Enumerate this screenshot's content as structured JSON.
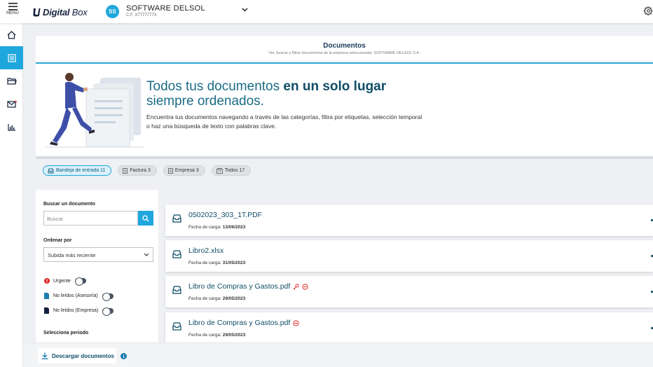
{
  "topbar": {
    "menu_label": "MENÚ",
    "logo_text_bold": "Digital",
    "logo_text_light": "Box",
    "avatar_initials": "SS",
    "company_name": "SOFTWARE DELSOL",
    "company_cif": "C.F. X7777777X"
  },
  "sidebar": {
    "items": [
      {
        "name": "home",
        "icon": "home-icon",
        "active": false
      },
      {
        "name": "documents",
        "icon": "documents-icon",
        "active": true
      },
      {
        "name": "folders",
        "icon": "folder-icon",
        "active": false
      },
      {
        "name": "messages",
        "icon": "mail-icon",
        "active": false
      },
      {
        "name": "reports",
        "icon": "chart-icon",
        "active": false
      }
    ]
  },
  "panel": {
    "title": "Documentos",
    "subtitle": "Ver, buscar y filtrar documentos de la empresa seleccionada: SOFTWARE DELSOL S.A.",
    "hero_title_regular": "Todos tus documentos",
    "hero_title_bold": "en un solo lugar",
    "hero_title_line2": "siempre ordenados.",
    "hero_text": "Encuentra tus documentos navegando a través de las categorías, filtra por etiquetas, selección temporal o haz una búsqueda de texto con palabras clave."
  },
  "tags": [
    {
      "label": "Bandeja de entrada 11",
      "active": true
    },
    {
      "label": "Factura 3",
      "active": false
    },
    {
      "label": "Empresa 3",
      "active": false
    },
    {
      "label": "Todos 17",
      "active": false
    }
  ],
  "filters": {
    "search_label": "Buscar un documento",
    "search_placeholder": "Buscar",
    "order_label": "Ordenar por",
    "order_value": "Subida más reciente",
    "toggle_urgent": "Urgente",
    "toggle_unread_advisory": "No leídos (Asesoría)",
    "toggle_unread_company": "No leídos (Empresa)",
    "period_label": "Selecciona periodo"
  },
  "documents": [
    {
      "name": "0502023_303_1T.PDF",
      "date_label": "Fecha de carga:",
      "date": "13/06/2023",
      "badges": []
    },
    {
      "name": "Libro2.xlsx",
      "date_label": "Fecha de carga:",
      "date": "31/05/2023",
      "badges": []
    },
    {
      "name": "Libro de Compras y Gastos.pdf",
      "date_label": "Fecha de carga:",
      "date": "29/05/2023",
      "badges": [
        "key-icon",
        "blocked-icon"
      ]
    },
    {
      "name": "Libro de Compras y Gastos.pdf",
      "date_label": "Fecha de carga:",
      "date": "29/05/2023",
      "badges": [
        "blocked-icon"
      ]
    }
  ],
  "bottombar": {
    "download_label": "Descargar documentos"
  },
  "colors": {
    "accent": "#1ea7dd",
    "dark_blue": "#0f4d66",
    "urgent": "#e02424"
  }
}
